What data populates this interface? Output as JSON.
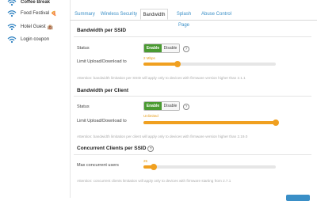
{
  "sidebar": {
    "items": [
      {
        "label": "Coffee Break",
        "emoji": ""
      },
      {
        "label": "Food Festival",
        "emoji": "🍕"
      },
      {
        "label": "Hotel Guest",
        "emoji": "🏨"
      },
      {
        "label": "Login coupon",
        "emoji": ""
      }
    ]
  },
  "tabs": [
    "Summary",
    "Wireless Security",
    "Bandwidth",
    "Splash Page",
    "Abuse Control"
  ],
  "active_tab": "Bandwidth",
  "ssid_section": {
    "title": "Bandwidth per SSID",
    "status_label": "Status",
    "enable_label": "Enable",
    "disable_label": "Disable",
    "limit_label": "Limit Upload/Download to",
    "slider_value_text": "2 Mbps",
    "slider_fraction": 0.26,
    "note": "Attention: bandwidth limitation per SSID will apply only to devices with firmware version higher than 2.1.1"
  },
  "client_section": {
    "title": "Bandwidth per Client",
    "status_label": "Status",
    "enable_label": "Enable",
    "disable_label": "Disable",
    "limit_label": "Limit Upload/Download to",
    "slider_value_text": "Unlimited",
    "slider_fraction": 1.0,
    "note": "Attention: bandwidth limitation per client will apply only to devices with firmware version higher than 2.19.0"
  },
  "concurrent_section": {
    "title": "Concurrent Clients per SSID",
    "max_label": "Max concurrent users",
    "slider_value_text": "25",
    "slider_fraction": 0.08,
    "note": "Attention: concurrent clients limitation will apply only to devices with firmware starting from 2.7.1"
  },
  "colors": {
    "accent": "#f0a020",
    "enable_green": "#4a9a31",
    "link_blue": "#3a8fc7",
    "wifi_blue": "#2a7fc0"
  },
  "icons": {
    "wifi": "wifi-icon",
    "help": "help-icon"
  }
}
